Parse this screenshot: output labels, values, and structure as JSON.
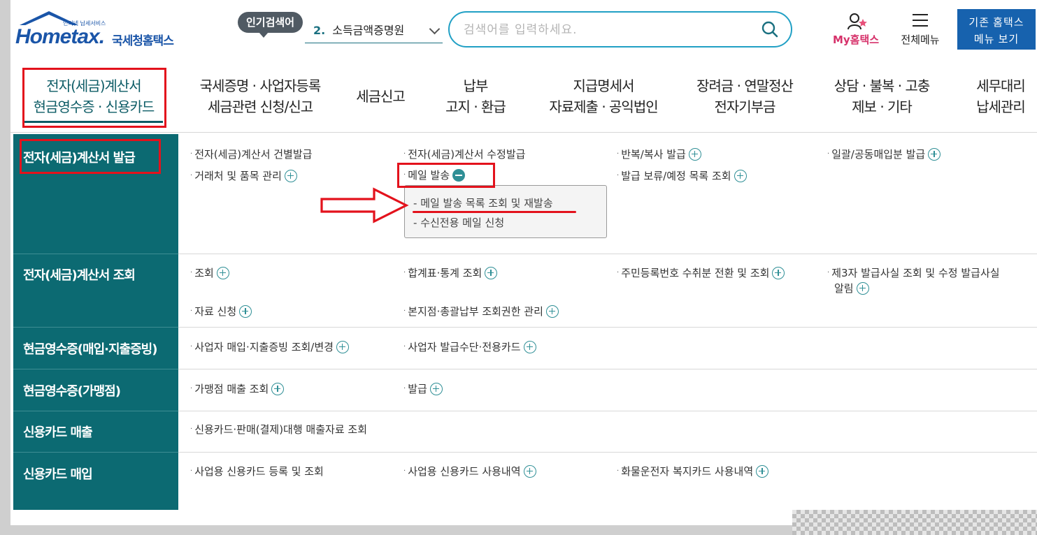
{
  "header": {
    "logo_small": "인터넷 납세서비스",
    "logo_word": "Hometax.",
    "logo_ko": "국세청홈택스",
    "popular_label": "인기검색어",
    "popular_rank": "2.",
    "popular_term": "소득금액증명원",
    "search_placeholder": "검색어를 입력하세요.",
    "my_hometax": "My홈택스",
    "menu_all": "전체메뉴",
    "legacy_line1": "기존 홈택스",
    "legacy_line2": "메뉴 보기"
  },
  "nav": [
    {
      "line1": "전자(세금)계산서",
      "line2": "현금영수증 · 신용카드"
    },
    {
      "line1": "국세증명 · 사업자등록",
      "line2": "세금관련 신청/신고"
    },
    {
      "line1": "세금신고",
      "line2": ""
    },
    {
      "line1": "납부",
      "line2": "고지 · 환급"
    },
    {
      "line1": "지급명세서",
      "line2": "자료제출 · 공익법인"
    },
    {
      "line1": "장려금 · 연말정산",
      "line2": "전자기부금"
    },
    {
      "line1": "상담 · 불복 · 고충",
      "line2": "제보 · 기타"
    },
    {
      "line1": "세무대리",
      "line2": "납세관리"
    }
  ],
  "side": [
    "전자(세금)계산서 발급",
    "전자(세금)계산서 조회",
    "현금영수증(매입·지출증빙)",
    "현금영수증(가맹점)",
    "신용카드 매출",
    "신용카드 매입"
  ],
  "links": {
    "issue": [
      "전자(세금)계산서 건별발급",
      "전자(세금)계산서 수정발급",
      "반복/복사 발급",
      "일괄/공동매입분 발급",
      "거래처 및 품목 관리",
      "메일 발송",
      "발급 보류/예정 목록 조회"
    ],
    "mail_sub": [
      "메일 발송 목록 조회 및 재발송",
      "수신전용 메일 신청"
    ],
    "inquiry": [
      "조회",
      "합계표·통계 조회",
      "주민등록번호 수취분 전환 및 조회",
      "제3자 발급사실 조회 및 수정 발급사실",
      "알림",
      "자료 신청",
      "본지점·총괄납부 조회권한 관리"
    ],
    "cash_buy": [
      "사업자 매입·지출증빙 조회/변경",
      "사업자 발급수단·전용카드"
    ],
    "cash_store": [
      "가맹점 매출 조회",
      "발급"
    ],
    "card_sales": [
      "신용카드·판매(결제)대행 매출자료 조회"
    ],
    "card_buy": [
      "사업용 신용카드 등록 및 조회",
      "사업용 신용카드 사용내역",
      "화물운전자 복지카드 사용내역"
    ]
  },
  "colors": {
    "accent": "#0c6a72",
    "brand": "#1a55a8",
    "highlight": "#e3121c",
    "search_border": "#21a0c5"
  }
}
